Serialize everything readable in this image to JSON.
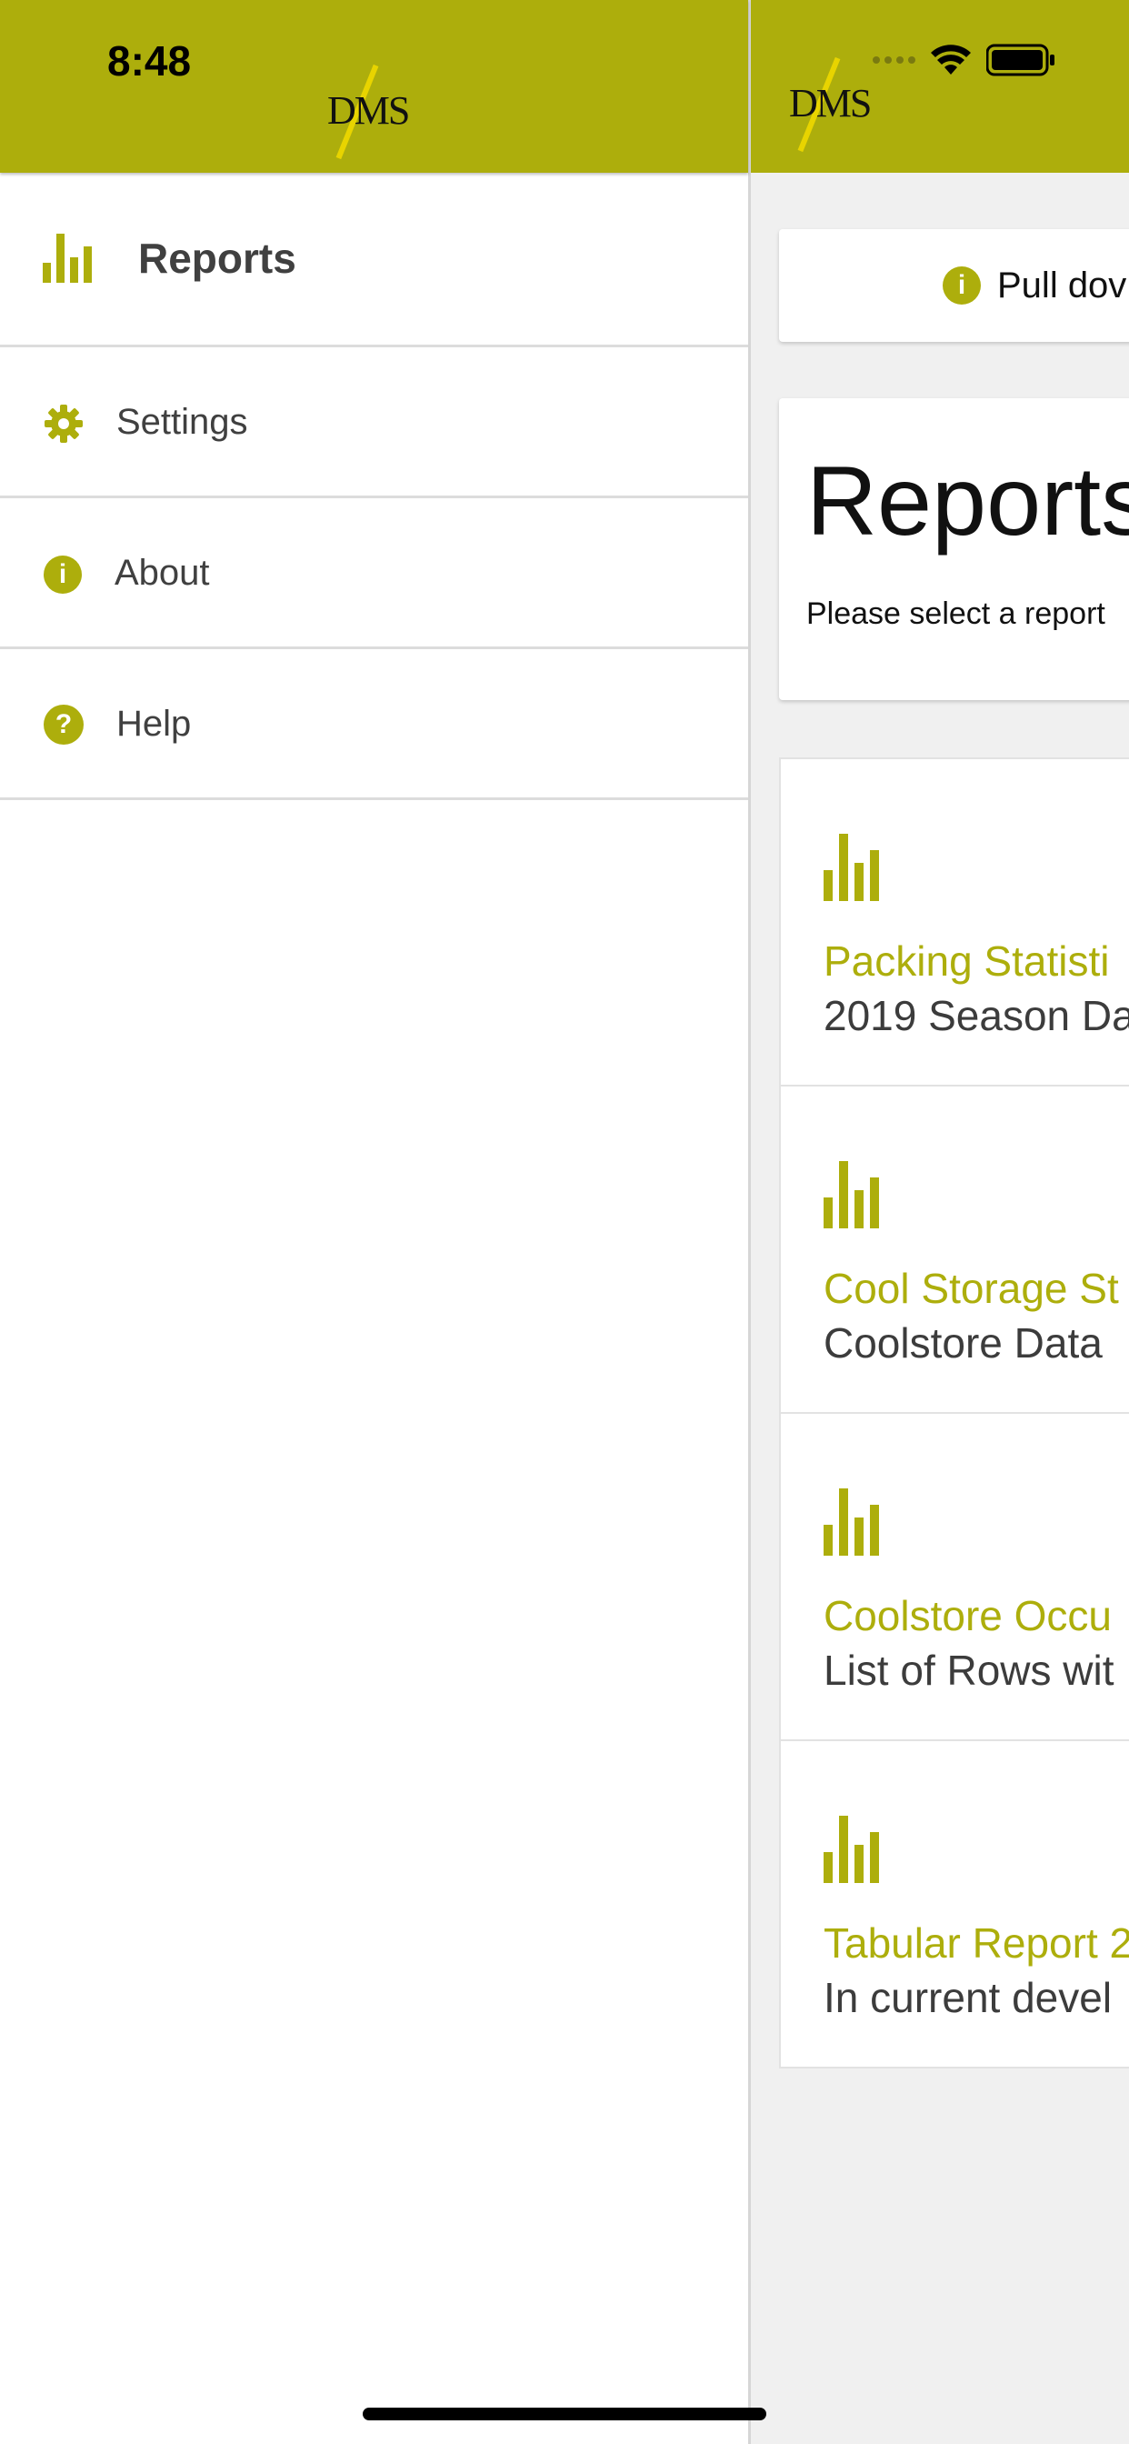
{
  "status_bar": {
    "time": "8:48"
  },
  "app": {
    "logo_text": "DMS"
  },
  "drawer": {
    "items": [
      {
        "label": "Reports",
        "icon": "bar-chart-icon",
        "active": true
      },
      {
        "label": "Settings",
        "icon": "gear-icon"
      },
      {
        "label": "About",
        "icon": "info-icon"
      },
      {
        "label": "Help",
        "icon": "help-icon"
      }
    ]
  },
  "main": {
    "hint": "Pull dov",
    "page_title": "Reports",
    "page_subtitle": "Please select a report",
    "reports": [
      {
        "title": "Packing Statisti",
        "subtitle": "2019 Season Da"
      },
      {
        "title": "Cool Storage St",
        "subtitle": "Coolstore Data"
      },
      {
        "title": "Coolstore Occu",
        "subtitle": "List of Rows wit"
      },
      {
        "title": "Tabular Report 2",
        "subtitle": "In current devel"
      }
    ]
  },
  "colors": {
    "accent": "#adae0c",
    "background": "#f0f0f0"
  }
}
